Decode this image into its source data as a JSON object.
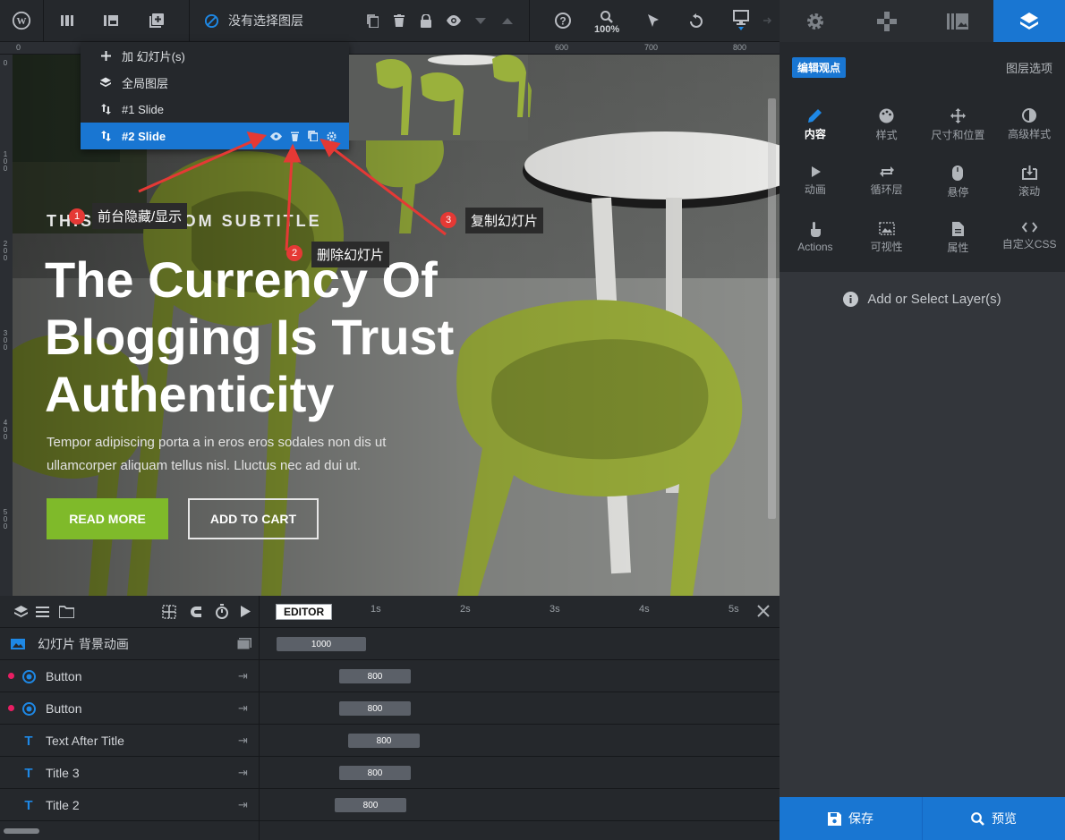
{
  "toolbar": {
    "layer_status": "没有选择图层",
    "zoom": "100%"
  },
  "ruler": {
    "top_ticks": [
      "0",
      "600",
      "700",
      "800"
    ],
    "left_ticks": [
      "0",
      "100",
      "200",
      "300",
      "400",
      "500"
    ]
  },
  "slides_menu": {
    "items": [
      {
        "label": "加 幻灯片(s)",
        "icon": "plus-icon"
      },
      {
        "label": "全局图层",
        "icon": "layers-icon"
      },
      {
        "label": "#1 Slide",
        "icon": "sort-icon"
      },
      {
        "label": "#2 Slide",
        "icon": "sort-icon",
        "active": true
      }
    ]
  },
  "slide": {
    "subtitle": "THIS IS CUSTOM SUBTITLE",
    "title": "The Currency Of Blogging Is Trust Authenticity",
    "description": "Tempor adipiscing porta a in eros eros sodales non dis ut ullamcorper aliquam tellus nisl. Lluctus nec ad dui ut.",
    "button_primary": "READ MORE",
    "button_secondary": "ADD TO CART",
    "accent": "#7fba2a"
  },
  "annotations": [
    {
      "num": "1",
      "text": "前台隐藏/显示"
    },
    {
      "num": "2",
      "text": "删除幻灯片"
    },
    {
      "num": "3",
      "text": "复制幻灯片"
    }
  ],
  "right_panel": {
    "header_pill": "编辑观点",
    "header_link": "图层选项",
    "grid": [
      {
        "label": "内容",
        "icon": "pencil-icon",
        "active": true
      },
      {
        "label": "样式",
        "icon": "palette-icon"
      },
      {
        "label": "尺寸和位置",
        "icon": "move-icon"
      },
      {
        "label": "高级样式",
        "icon": "contrast-icon"
      },
      {
        "label": "动画",
        "icon": "play-icon"
      },
      {
        "label": "循环层",
        "icon": "loop-icon"
      },
      {
        "label": "悬停",
        "icon": "mouse-icon"
      },
      {
        "label": "滚动",
        "icon": "scroll-icon"
      },
      {
        "label": "Actions",
        "icon": "touch-icon"
      },
      {
        "label": "可视性",
        "icon": "visibility-icon"
      },
      {
        "label": "属性",
        "icon": "document-icon"
      },
      {
        "label": "自定义CSS",
        "icon": "code-icon"
      }
    ],
    "hint": "Add or Select Layer(s)",
    "save": "保存",
    "preview": "预览",
    "brand_color": "#1976d2"
  },
  "timeline": {
    "editor_label": "EDITOR",
    "seconds": [
      "1s",
      "2s",
      "3s",
      "4s",
      "5s"
    ],
    "rows": [
      {
        "name": "幻灯片 背景动画",
        "icon": "image-icon",
        "bar": "1000",
        "dot": false
      },
      {
        "name": "Button",
        "icon": "button-icon",
        "bar": "800",
        "dot": true
      },
      {
        "name": "Button",
        "icon": "button-icon",
        "bar": "800",
        "dot": true
      },
      {
        "name": "Text After Title",
        "icon": "text-icon",
        "bar": "800",
        "dot": false
      },
      {
        "name": "Title 3",
        "icon": "text-icon",
        "bar": "800",
        "dot": false
      },
      {
        "name": "Title 2",
        "icon": "text-icon",
        "bar": "800",
        "dot": false
      }
    ]
  }
}
